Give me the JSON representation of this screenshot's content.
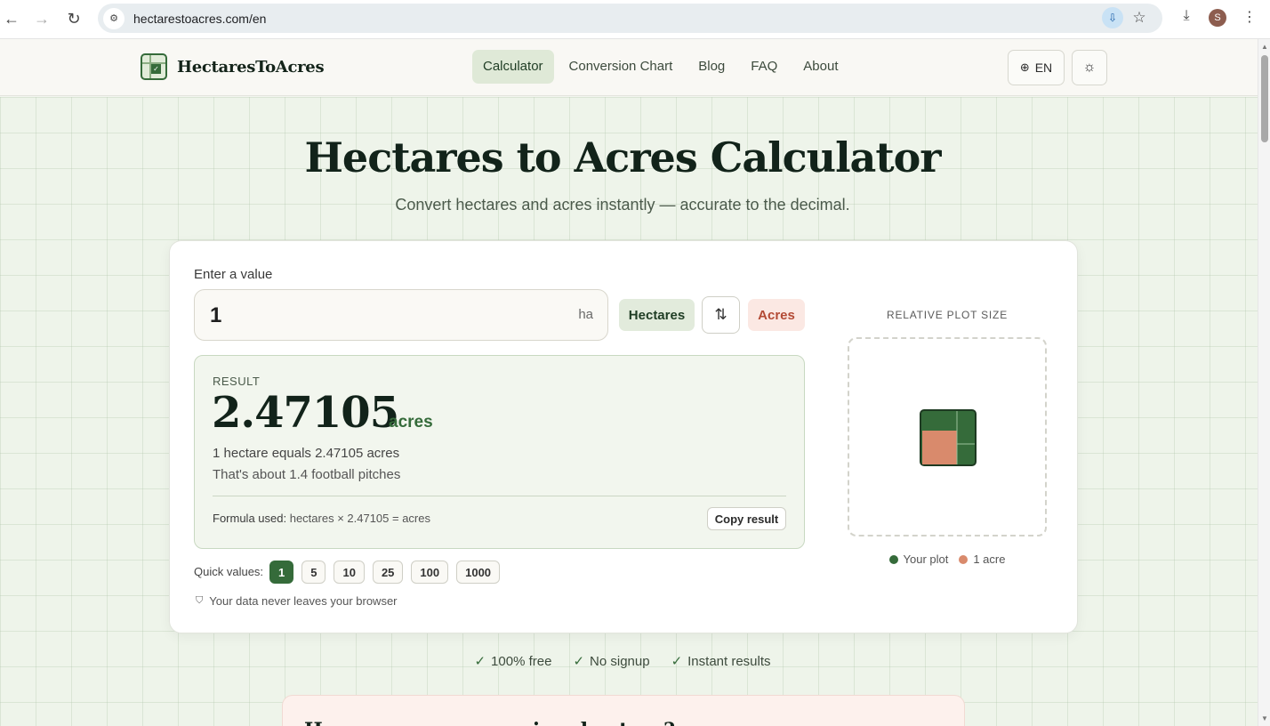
{
  "browser": {
    "url": "hectarestoacres.com/en",
    "profile_initial": "S"
  },
  "header": {
    "logo_text": "HectaresToAcres",
    "nav": [
      {
        "label": "Calculator",
        "active": true
      },
      {
        "label": "Conversion Chart",
        "active": false
      },
      {
        "label": "Blog",
        "active": false
      },
      {
        "label": "FAQ",
        "active": false
      },
      {
        "label": "About",
        "active": false
      }
    ],
    "language": "EN"
  },
  "hero": {
    "title": "Hectares to Acres Calculator",
    "subtitle": "Convert hectares and acres instantly — accurate to the decimal."
  },
  "calculator": {
    "input_label": "Enter a value",
    "input_value": "1",
    "input_unit": "ha",
    "from_unit": "Hectares",
    "to_unit": "Acres",
    "result_label": "RESULT",
    "result_value": "2.47105",
    "result_unit": "acres",
    "equivalence": "1 hectare equals 2.47105 acres",
    "football": "That's about 1.4 football pitches",
    "formula_label": "Formula used:",
    "formula": "hectares × 2.47105 = acres",
    "copy_label": "Copy result",
    "quick_label": "Quick values:",
    "quick_values": [
      "1",
      "5",
      "10",
      "25",
      "100",
      "1000"
    ],
    "quick_active": "1",
    "privacy": "Your data never leaves your browser"
  },
  "plot": {
    "title": "RELATIVE PLOT SIZE",
    "your_plot_acres": 2.47105,
    "legend": [
      {
        "label": "Your plot",
        "color": "#356b3a"
      },
      {
        "label": "1 acre",
        "color": "#d98a6c"
      }
    ]
  },
  "badges": [
    "100% free",
    "No signup",
    "Instant results"
  ],
  "next_section": {
    "heading": "How many acres are in a hectare?"
  },
  "colors": {
    "accent": "#356b3a",
    "accent_soft": "#e2ebdc",
    "acre": "#d98a6c",
    "text": "#12231a"
  }
}
